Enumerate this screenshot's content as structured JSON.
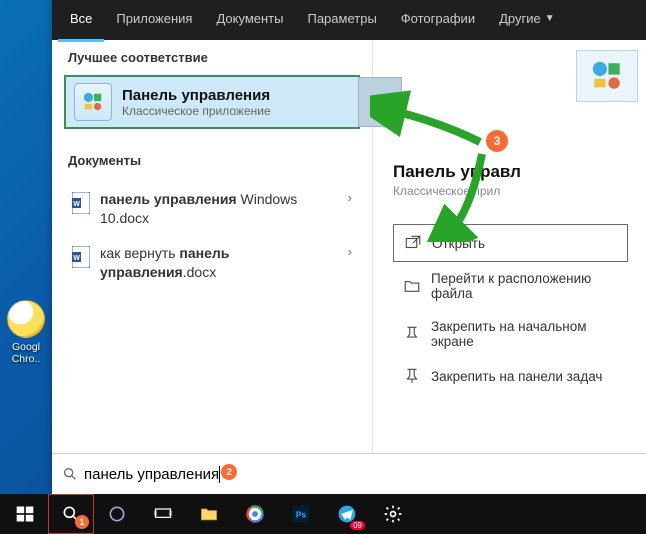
{
  "tabs": [
    "Все",
    "Приложения",
    "Документы",
    "Параметры",
    "Фотографии",
    "Другие"
  ],
  "bestMatchHeader": "Лучшее соответствие",
  "bestMatch": {
    "title": "Панель управления",
    "subtitle": "Классическое приложение"
  },
  "documentsHeader": "Документы",
  "docs": [
    {
      "pre": "панель управления",
      "post": " Windows 10.docx"
    },
    {
      "pre": "как вернуть ",
      "bold": "панель управления",
      "post": ".docx"
    }
  ],
  "rightPane": {
    "title": "Панель управл",
    "subtitle": "Классическое прил"
  },
  "actions": [
    "Открыть",
    "Перейти к расположению файла",
    "Закрепить на начальном экране",
    "Закрепить на панели задач"
  ],
  "searchValue": "панель управления",
  "desktopIcon": "Googl Chro..",
  "annotations": {
    "b1": "1",
    "b2": "2",
    "b3": "3"
  }
}
